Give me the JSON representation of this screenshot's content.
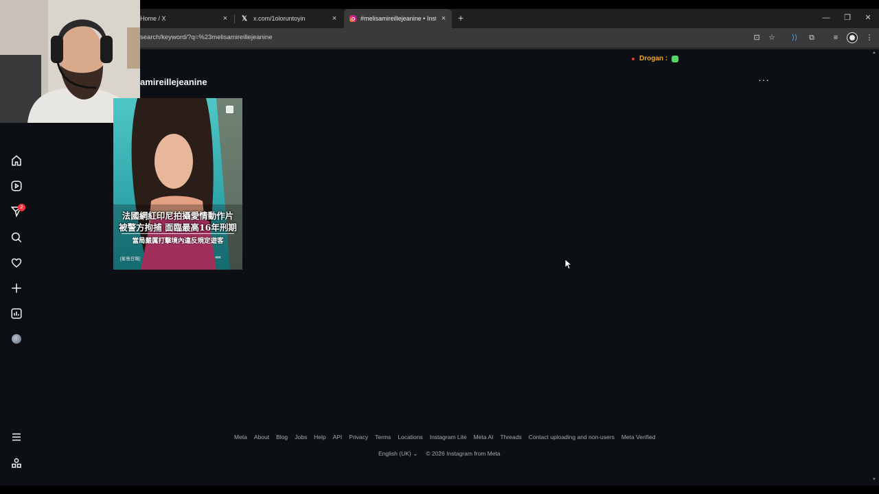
{
  "browser": {
    "tabs": [
      {
        "label": "Home / X",
        "close": "×",
        "favicon": "x-favicon"
      },
      {
        "label": "x.com/1oloruntoyin",
        "close": "×",
        "favicon": "x-favicon"
      },
      {
        "label": "#melisamireillejeanine • Instagram",
        "close": "×",
        "favicon": "instagram-favicon",
        "active": true
      }
    ],
    "new_tab": "+",
    "window_controls": {
      "minimize": "—",
      "restore": "❐",
      "close": "✕"
    },
    "url": "search/keyword/?q=%23melisamireillejeanine"
  },
  "overlay": {
    "label": "Drogan :",
    "accent": "#f5a524"
  },
  "instagram": {
    "sidebar_icons": [
      "home-icon",
      "reels-icon",
      "notifications-icon",
      "search-icon",
      "heart-icon",
      "create-icon",
      "dashboard-icon",
      "profile-avatar",
      "menu-icon",
      "more-apps-icon"
    ],
    "notification_count": "2",
    "hashtag_title": "amireillejeanine",
    "more": "···",
    "post": {
      "caption_line1": "法國網紅印尼拍攝愛情動作片",
      "caption_line2": "被警方拘捕 面臨最高16年刑期",
      "caption_line3": "當局嚴厲打擊境內違反規定遊客",
      "source": "[星島日報]",
      "arrows": "‹‹‹‹‹‹"
    },
    "footer_links": [
      "Meta",
      "About",
      "Blog",
      "Jobs",
      "Help",
      "API",
      "Privacy",
      "Terms",
      "Locations",
      "Instagram Lite",
      "Meta AI",
      "Threads",
      "Contact uploading and non-users",
      "Meta Verified"
    ],
    "language": "English (UK)",
    "language_chevron": "⌄",
    "copyright": "© 2026 Instagram from Meta"
  }
}
